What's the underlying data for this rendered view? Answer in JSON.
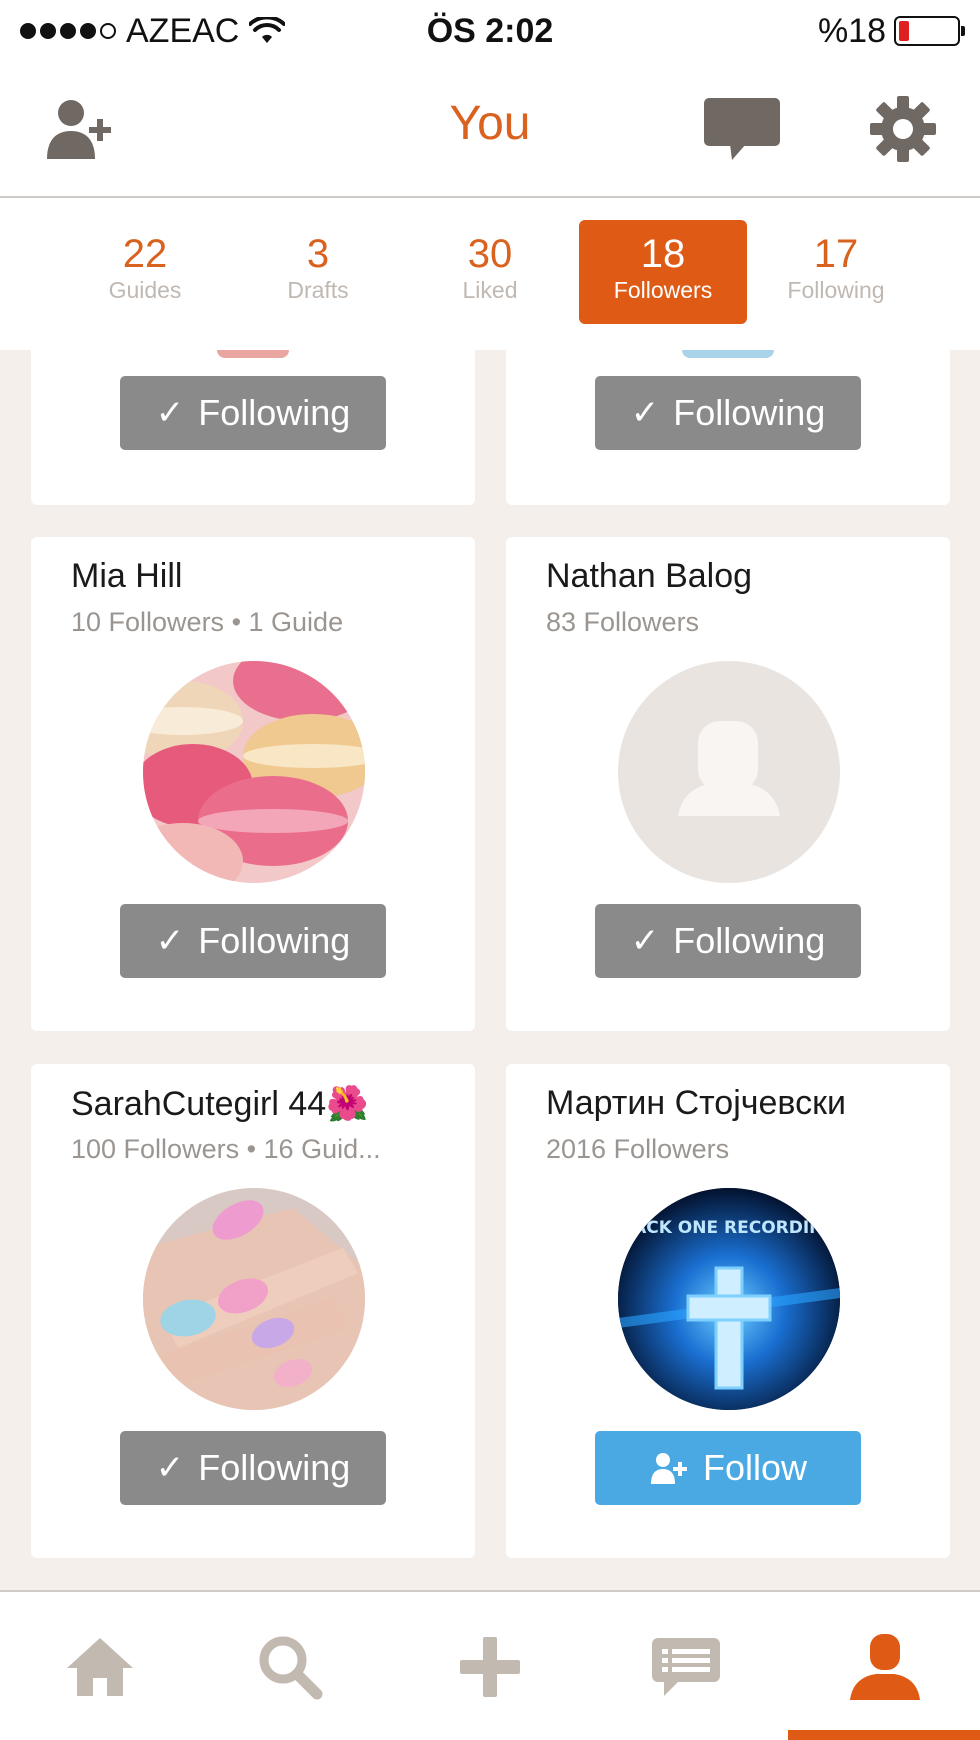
{
  "status_bar": {
    "carrier": "AZEAC",
    "time": "ÖS 2:02",
    "battery": "%18",
    "battery_level": 0.18
  },
  "nav": {
    "title": "You",
    "left_icon": "add-user-icon",
    "message_icon": "message-icon",
    "settings_icon": "gear-icon"
  },
  "tabs": [
    {
      "count": "22",
      "label": "Guides",
      "active": false
    },
    {
      "count": "3",
      "label": "Drafts",
      "active": false
    },
    {
      "count": "30",
      "label": "Liked",
      "active": false
    },
    {
      "count": "18",
      "label": "Followers",
      "active": true
    },
    {
      "count": "17",
      "label": "Following",
      "active": false
    }
  ],
  "cards": [
    {
      "name": "",
      "meta": "",
      "button": "Following",
      "state": "following"
    },
    {
      "name": "",
      "meta": "",
      "button": "Following",
      "state": "following"
    },
    {
      "name": "Mia Hill",
      "meta": "10 Followers • 1 Guide",
      "avatar": "macarons-photo",
      "button": "Following",
      "state": "following"
    },
    {
      "name": "Nathan Balog",
      "meta": "83 Followers",
      "avatar": "default-user-avatar",
      "button": "Following",
      "state": "following"
    },
    {
      "name": "SarahCutegirl 44🌺",
      "meta": "100 Followers • 16 Guid...",
      "avatar": "nails-photo",
      "button": "Following",
      "state": "following"
    },
    {
      "name": "Мартин Стојчевски",
      "meta": "2016 Followers",
      "avatar": "trackone-recordings-logo",
      "avatar_text": "TRACK ONE RECORDINGS",
      "button": "Follow",
      "state": "follow"
    }
  ],
  "tab_bar": {
    "items": [
      "home-icon",
      "search-icon",
      "plus-icon",
      "chat-icon",
      "profile-icon"
    ],
    "active": "profile-icon"
  },
  "colors": {
    "accent": "#df5b15",
    "following_button": "#8a8a8a",
    "follow_button": "#4aa8e3",
    "background": "#f4efeb"
  }
}
